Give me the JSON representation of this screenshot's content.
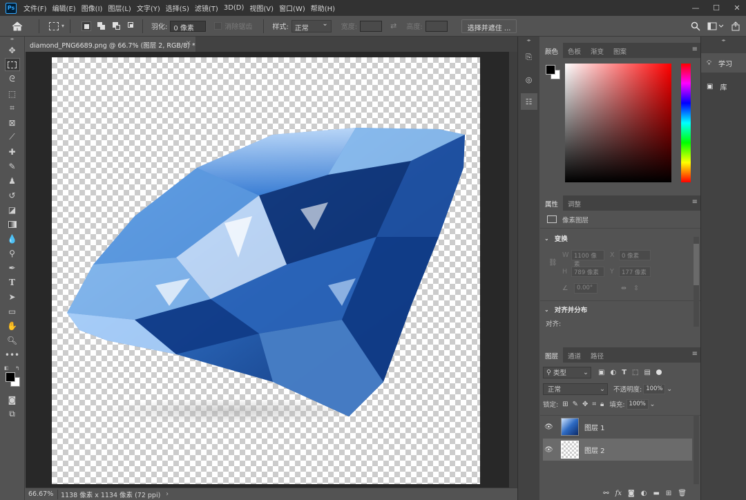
{
  "app": {
    "logo": "Ps"
  },
  "menu": [
    "文件(F)",
    "编辑(E)",
    "图像(I)",
    "图层(L)",
    "文字(Y)",
    "选择(S)",
    "滤镜(T)",
    "3D(D)",
    "视图(V)",
    "窗口(W)",
    "帮助(H)"
  ],
  "window": {
    "minimize": "—",
    "maximize": "☐",
    "close": "✕"
  },
  "options": {
    "feather_label": "羽化:",
    "feather_value": "0 像素",
    "antialias_label": "消除锯齿",
    "style_label": "样式:",
    "style_value": "正常",
    "width_label": "宽度:",
    "height_label": "高度:",
    "select_mask_button": "选择并遮住 ..."
  },
  "document": {
    "tab_title": "diamond_PNG6689.png @ 66.7% (图层 2, RGB/8) *",
    "tab_close": "×",
    "zoom": "66.67%",
    "doc_info": "1138 像素 x 1134 像素 (72 ppi)",
    "status_arrow": "›"
  },
  "color_panel": {
    "tabs": [
      "颜色",
      "色板",
      "渐变",
      "图案"
    ],
    "active_tab": 0,
    "foreground": "#000000",
    "background": "#ffffff",
    "hue_color": "#ff0000"
  },
  "properties_panel": {
    "tabs": [
      "属性",
      "调整"
    ],
    "layer_type": "像素图层",
    "transform_heading": "变换",
    "w_label": "W",
    "w_value": "1100 像素",
    "x_label": "X",
    "x_value": "0 像素",
    "h_label": "H",
    "h_value": "789 像素",
    "y_label": "Y",
    "y_value": "177 像素",
    "angle_value": "0.00°",
    "align_heading": "对齐并分布",
    "align_label": "对齐:"
  },
  "layers_panel": {
    "tabs": [
      "图层",
      "通道",
      "路径"
    ],
    "filter_label": "类型",
    "blend_mode": "正常",
    "opacity_label": "不透明度:",
    "opacity_value": "100%",
    "lock_label": "锁定:",
    "fill_label": "填充:",
    "fill_value": "100%",
    "layers": [
      {
        "name": "图层 1",
        "visible": true,
        "selected": false
      },
      {
        "name": "图层 2",
        "visible": true,
        "selected": true
      }
    ],
    "footer_fx": "fx"
  },
  "right_dock": {
    "learn_label": "学习",
    "library_label": "库"
  },
  "colors": {
    "accent": "#31a8ff",
    "selected_layer": "#6b6b6b"
  }
}
